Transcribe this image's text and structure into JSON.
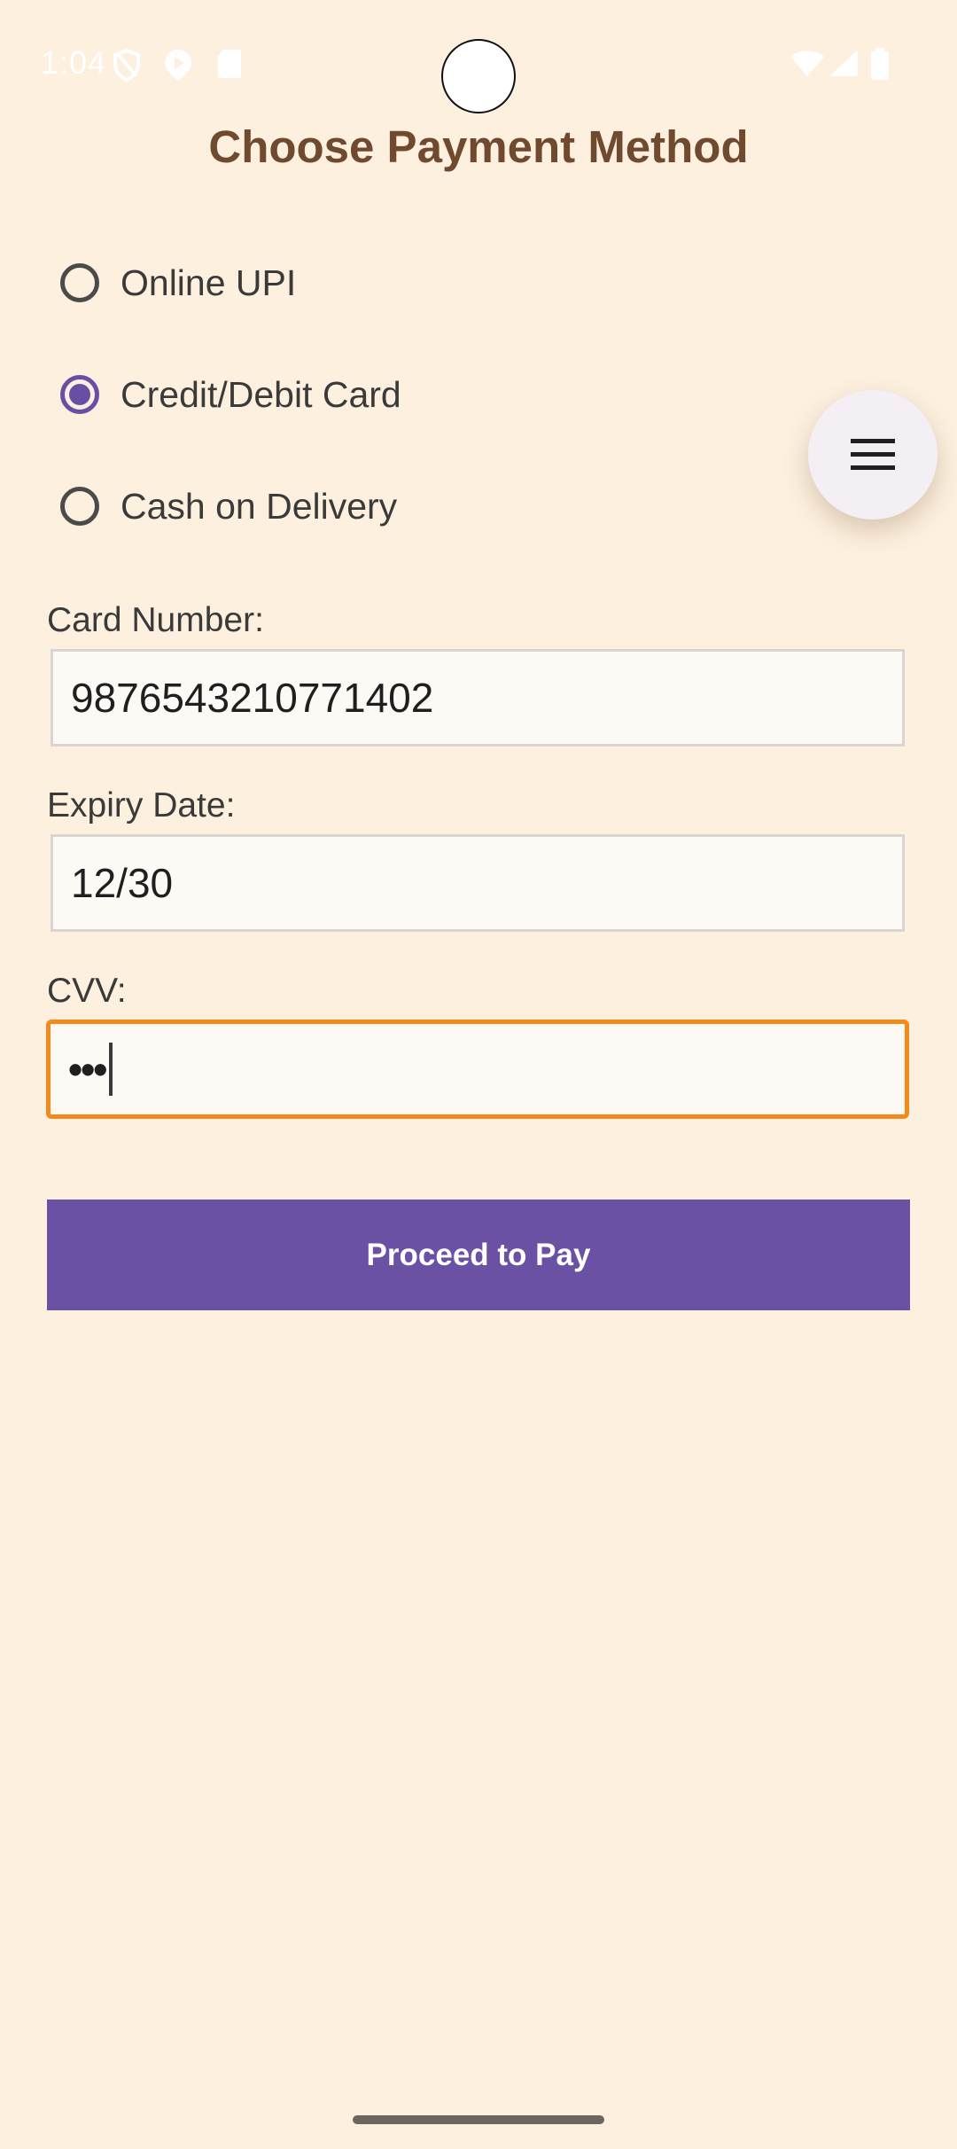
{
  "status_bar": {
    "time": "1:04",
    "left_icons": [
      "shield-icon",
      "play-icon",
      "sd-card-icon"
    ],
    "right_icons": [
      "wifi-icon",
      "signal-icon",
      "battery-icon"
    ]
  },
  "page": {
    "title": "Choose Payment Method"
  },
  "payment_options": [
    {
      "label": "Online UPI",
      "selected": false
    },
    {
      "label": "Credit/Debit Card",
      "selected": true
    },
    {
      "label": "Cash on Delivery",
      "selected": false
    }
  ],
  "fab": {
    "icon": "menu-icon"
  },
  "form": {
    "card_number_label": "Card Number:",
    "card_number_value": "9876543210771402",
    "expiry_label": "Expiry Date:",
    "expiry_value": "12/30",
    "cvv_label": "CVV:",
    "cvv_value": "•••"
  },
  "actions": {
    "pay_label": "Proceed to Pay"
  },
  "colors": {
    "background": "#fdf0df",
    "title": "#6f4a2f",
    "accent": "#6750a4",
    "button": "#6a51a4",
    "focus_border": "#f48a1b"
  }
}
